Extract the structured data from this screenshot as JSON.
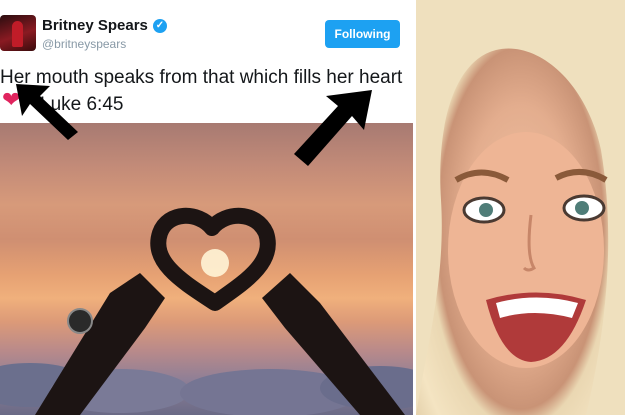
{
  "tweet": {
    "name": "Britney Spears",
    "handle": "@britneyspears",
    "follow_label": "Following",
    "text_line1": "Her mouth speaks from that which fills her heart",
    "text_line2": "Luke 6:45"
  },
  "colors": {
    "accent": "#1da1f2",
    "heart": "#e0245e",
    "arrow": "#000000"
  },
  "icons": [
    "verified-badge-icon",
    "heart-icon",
    "arrow-up-left-icon",
    "arrow-up-right-icon"
  ]
}
